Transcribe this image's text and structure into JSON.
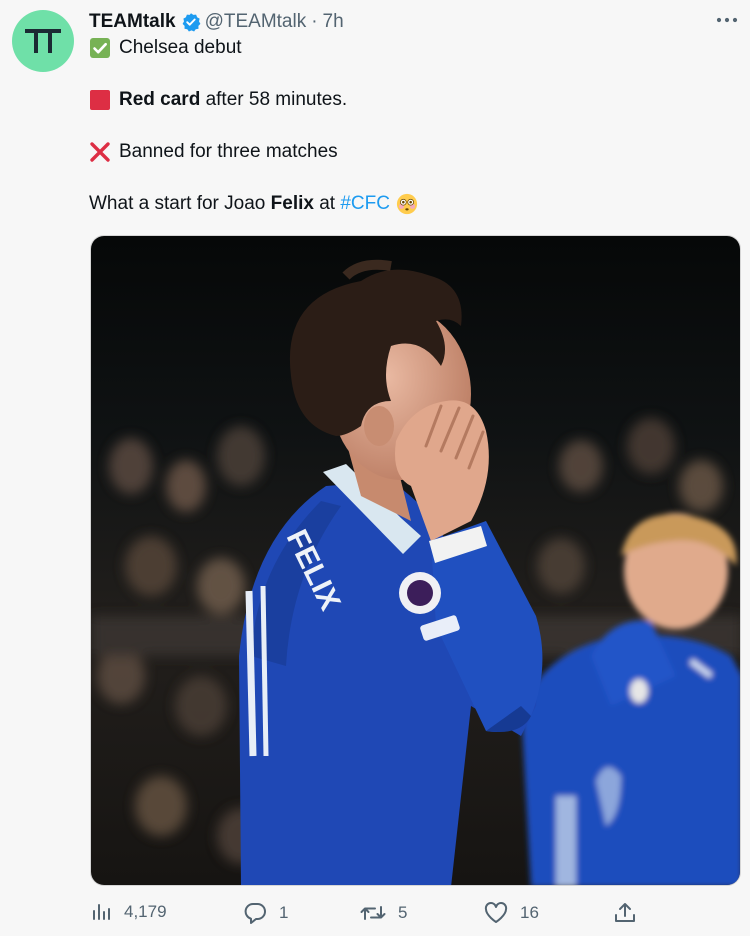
{
  "tweet": {
    "author": {
      "display_name": "TEAMtalk",
      "handle": "@TEAMtalk",
      "time": "7h",
      "separator": "·",
      "avatar_color": "#6fe0a8",
      "verified": true
    },
    "lines": {
      "l1_text": "Chelsea debut",
      "l2_bold": "Red card",
      "l2_rest": " after 58 minutes.",
      "l3_text": "Banned for three matches",
      "l4_pre": "What a start for Joao ",
      "l4_bold": "Felix",
      "l4_mid": " at ",
      "l4_hashtag": "#CFC"
    },
    "emojis": {
      "line1": "check-mark-button",
      "line2": "red-square",
      "line3": "cross-mark",
      "line4_end": "flushed-face"
    },
    "media": {
      "alt": "Photo of a footballer in a blue kit holding his face with both hands",
      "jersey_text": "FELIX"
    },
    "actions": {
      "views": "4,179",
      "replies": "1",
      "retweets": "5",
      "likes": "16"
    },
    "colors": {
      "link": "#1d9bf0",
      "muted": "#536471",
      "verified": "#1d9bf0",
      "kit_blue": "#1f48b5"
    }
  }
}
